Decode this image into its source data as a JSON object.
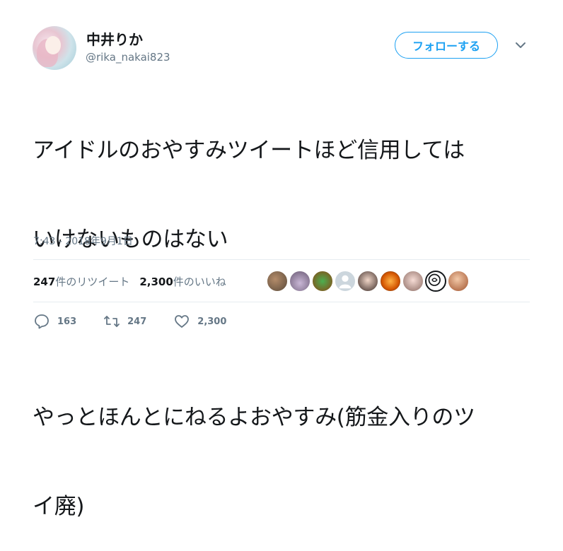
{
  "user": {
    "display_name": "中井りか",
    "handle": "@rika_nakai823"
  },
  "follow_button_label": "フォローする",
  "tweet": {
    "line1": "アイドルのおやすみツイートほど信用しては",
    "line2": "いけないものはない",
    "line3": "やっとほんとにねるよおやすみ(筋金入りのツ",
    "line4": "イ廃)"
  },
  "timestamp": "7:43 - 2018年9月1日",
  "stats": {
    "retweet_count": "247",
    "retweet_label": "件のリツイート",
    "like_count": "2,300",
    "like_label": " 件のいいね"
  },
  "actions": {
    "reply_count": "163",
    "retweet_count": "247",
    "like_count": "2,300"
  },
  "icons": {
    "reply": "reply-icon",
    "retweet": "retweet-icon",
    "like": "heart-icon",
    "caret": "chevron-down-icon"
  },
  "colors": {
    "accent": "#1da1f2",
    "text": "#14171a",
    "secondary": "#657786",
    "divider": "#e6ecf0"
  }
}
